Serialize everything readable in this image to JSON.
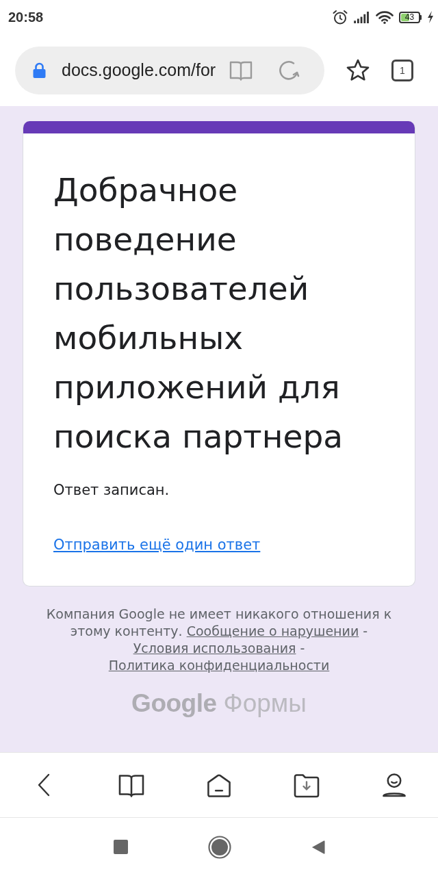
{
  "status_bar": {
    "time": "20:58",
    "battery": "43"
  },
  "browser": {
    "url": "docs.google.com/for",
    "tab_count": "1"
  },
  "form": {
    "title": "Добрачное поведение пользователей мобильных приложений для поиска партнера",
    "message": "Ответ записан.",
    "link": "Отправить ещё один ответ"
  },
  "footer": {
    "segments": [
      {
        "kind": "text",
        "text": "Компания Google не имеет никакого отношения к этому контенту."
      },
      {
        "kind": "link",
        "text": "Сообщение о нарушении"
      },
      {
        "kind": "text",
        "text": "-"
      },
      {
        "kind": "link",
        "text": "Условия использования"
      },
      {
        "kind": "text",
        "text": "-"
      },
      {
        "kind": "link",
        "text": "Политика конфиденциальности"
      }
    ]
  },
  "logo": {
    "brand": "Google",
    "product": "Формы"
  }
}
